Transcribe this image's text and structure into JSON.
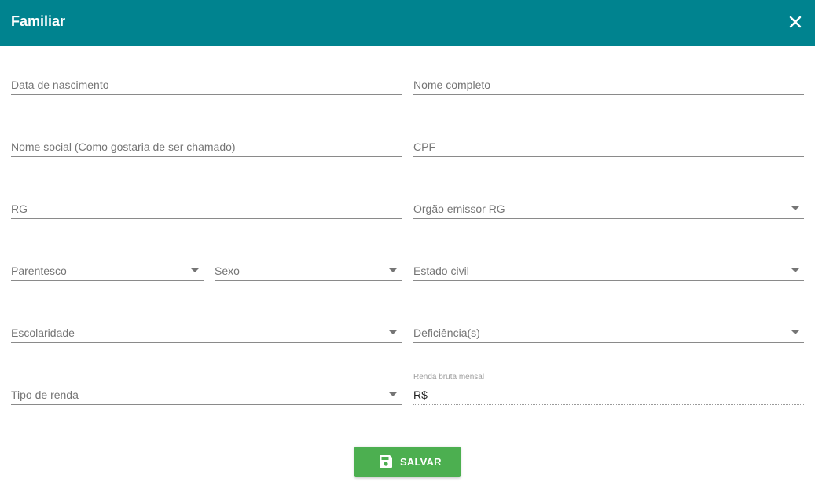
{
  "dialog": {
    "title": "Familiar",
    "close_icon": "close-icon",
    "header_color": "#00838f"
  },
  "form": {
    "birth_date": {
      "label": "Data de nascimento"
    },
    "full_name": {
      "label": "Nome completo"
    },
    "social_name": {
      "label": "Nome social (Como gostaria de ser chamado)"
    },
    "cpf": {
      "label": "CPF"
    },
    "rg": {
      "label": "RG"
    },
    "rg_issuer": {
      "label": "Orgão emissor RG"
    },
    "relationship": {
      "label": "Parentesco"
    },
    "sex": {
      "label": "Sexo"
    },
    "marital_status": {
      "label": "Estado civil"
    },
    "education": {
      "label": "Escolaridade"
    },
    "disabilities": {
      "label": "Deficiência(s)"
    },
    "income_type": {
      "label": "Tipo de renda"
    },
    "gross_income": {
      "label": "Renda bruta mensal",
      "value": "R$"
    }
  },
  "actions": {
    "save_label": "SALVAR",
    "save_icon": "floppy-disk-icon",
    "save_color": "#4caf50"
  }
}
